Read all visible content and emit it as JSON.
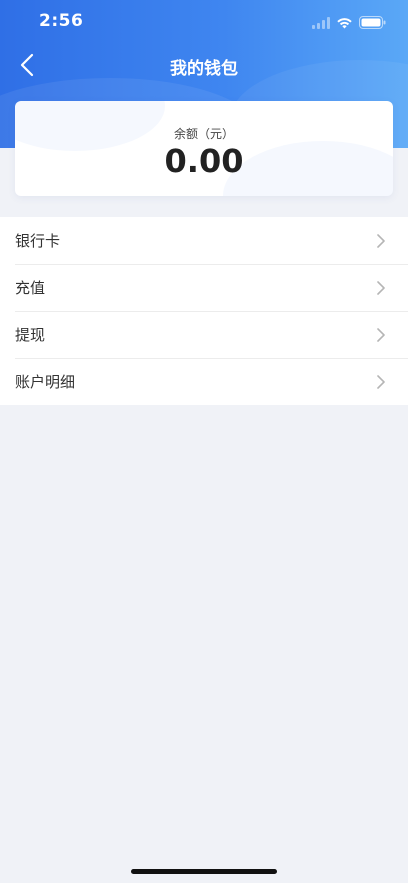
{
  "status_bar": {
    "time": "2:56",
    "icons": [
      "signal-icon",
      "wifi-icon",
      "battery-icon"
    ]
  },
  "nav": {
    "title": "我的钱包",
    "back_icon": "chevron-left-icon"
  },
  "balance": {
    "label": "余额（元）",
    "amount": "0.00"
  },
  "menu": {
    "items": [
      {
        "label": "银行卡",
        "icon": "chevron-right-icon"
      },
      {
        "label": "充值",
        "icon": "chevron-right-icon"
      },
      {
        "label": "提现",
        "icon": "chevron-right-icon"
      },
      {
        "label": "账户明细",
        "icon": "chevron-right-icon"
      }
    ]
  },
  "colors": {
    "header_gradient_start": "#2f6fe6",
    "header_gradient_end": "#5aa8f7",
    "page_background": "#f0f2f7"
  }
}
